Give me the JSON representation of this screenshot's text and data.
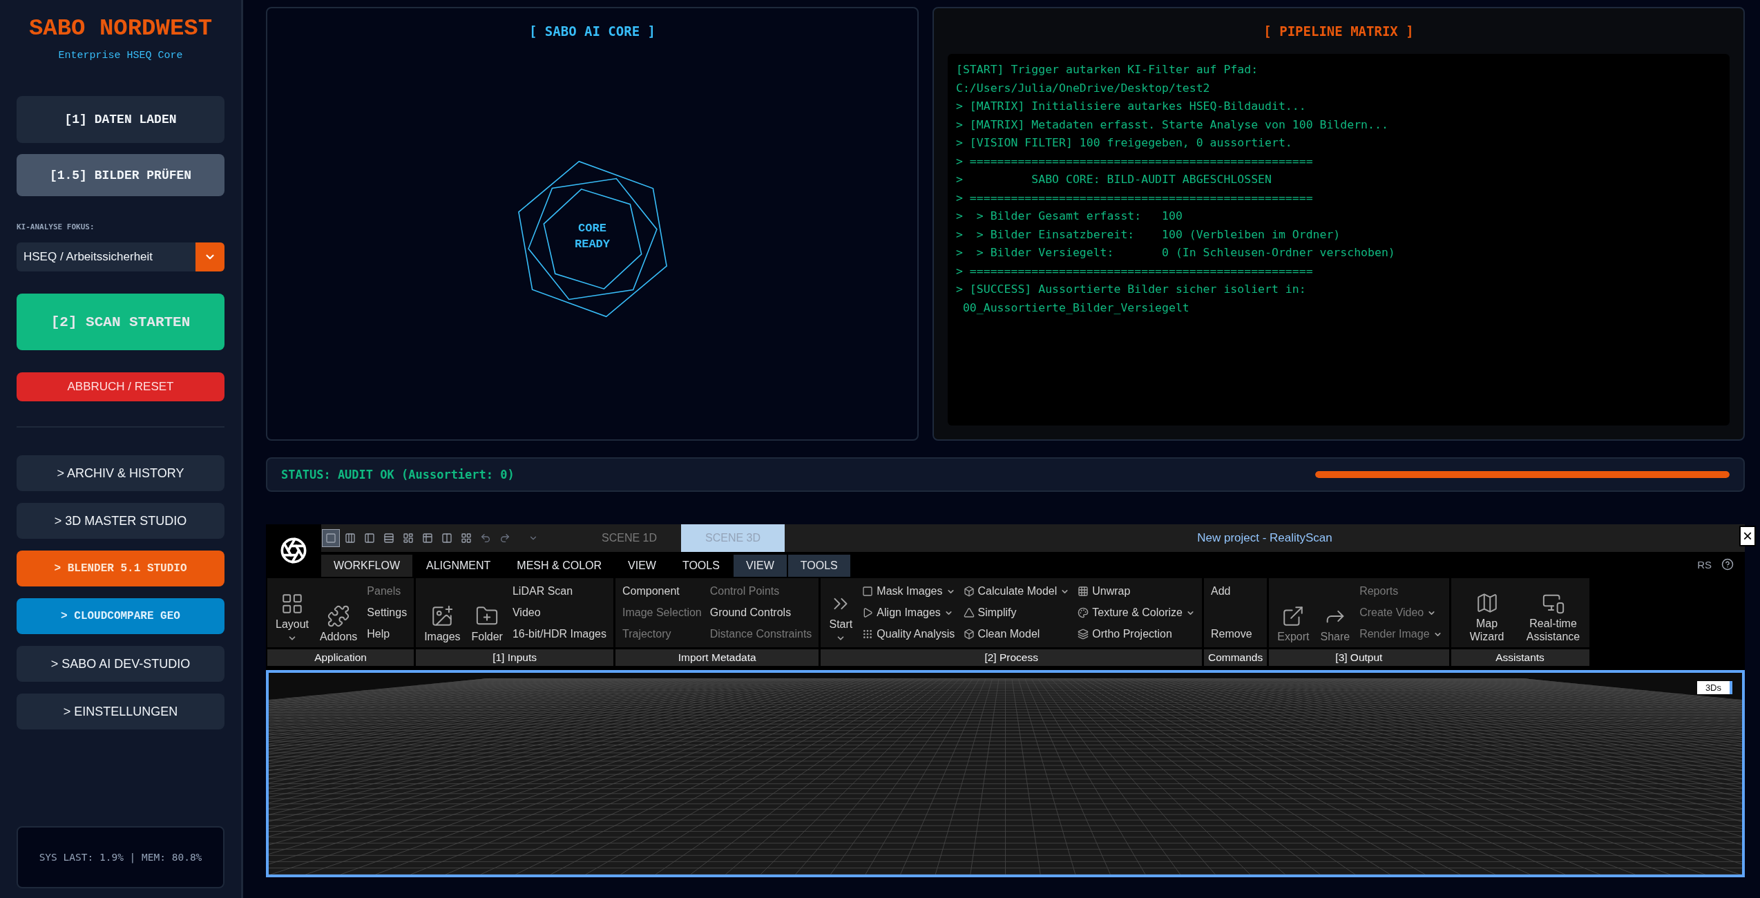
{
  "sidebar": {
    "brand": "SABO NORDWEST",
    "subtitle": "Enterprise HSEQ Core",
    "actions": [
      {
        "label": "[1] DATEN LADEN",
        "kind": "primary"
      },
      {
        "label": "[1.5] BILDER PRÜFEN",
        "kind": "secondary"
      }
    ],
    "focus": {
      "label": "KI-ANALYSE FOKUS:",
      "value": "HSEQ / Arbeitssicherheit"
    },
    "run_actions": [
      {
        "label": "[2] SCAN STARTEN",
        "kind": "scan"
      },
      {
        "label": "ABBRUCH / RESET",
        "kind": "danger"
      }
    ],
    "nav": [
      {
        "label": "> ARCHIV & HISTORY",
        "kind": "plain"
      },
      {
        "label": "> 3D MASTER STUDIO",
        "kind": "plain"
      },
      {
        "label": "> BLENDER 5.1 STUDIO",
        "kind": "orange"
      },
      {
        "label": "> CLOUDCOMPARE GEO",
        "kind": "blue"
      },
      {
        "label": "> SABO AI DEV-STUDIO",
        "kind": "plain"
      },
      {
        "label": "> EINSTELLUNGEN",
        "kind": "plain"
      }
    ],
    "sys": "SYS LAST: 1.9% | MEM: 80.8%"
  },
  "core": {
    "title": "[ SABO AI CORE ]",
    "lines": [
      "CORE",
      "READY"
    ]
  },
  "pipeline": {
    "title": "[ PIPELINE MATRIX ]",
    "log": [
      "[START] Trigger autarken KI-Filter auf Pfad:",
      "C:/Users/Julia/OneDrive/Desktop/test2",
      "> [MATRIX] Initialisiere autarkes HSEQ-Bildaudit...",
      "> [MATRIX] Metadaten erfasst. Starte Analyse von 100 Bildern...",
      "> [VISION FILTER] 100 freigegeben, 0 aussortiert.",
      "> ==================================================",
      ">          SABO CORE: BILD-AUDIT ABGESCHLOSSEN",
      "> ==================================================",
      ">  > Bilder Gesamt erfasst:   100",
      ">  > Bilder Einsatzbereit:    100 (Verbleiben im Ordner)",
      ">  > Bilder Versiegelt:       0 (In Schleusen-Ordner verschoben)",
      "> ==================================================",
      "> [SUCCESS] Aussortierte Bilder sicher isoliert in:",
      " 00_Aussortierte_Bilder_Versiegelt"
    ]
  },
  "status": {
    "text": "STATUS: AUDIT OK (Aussortiert: 0)",
    "level": 1
  },
  "realityscan": {
    "title": "New project - RealityScan",
    "close": "×",
    "layouts": [
      {
        "selected": true
      },
      {
        "selected": false
      },
      {
        "selected": false
      },
      {
        "selected": false
      },
      {
        "selected": false
      },
      {
        "selected": false
      },
      {
        "selected": false
      },
      {
        "selected": false
      }
    ],
    "scenes": [
      {
        "label": "SCENE 1D",
        "selected": false
      },
      {
        "label": "SCENE 3D",
        "selected": true
      }
    ],
    "tabs": [
      {
        "label": "WORKFLOW",
        "selected": true,
        "kind": "main"
      },
      {
        "label": "ALIGNMENT",
        "selected": false,
        "kind": "main"
      },
      {
        "label": "MESH & COLOR",
        "selected": false,
        "kind": "main"
      },
      {
        "label": "VIEW",
        "selected": false,
        "kind": "main"
      },
      {
        "label": "TOOLS",
        "selected": false,
        "kind": "main"
      },
      {
        "label": "VIEW",
        "selected": false,
        "kind": "context"
      },
      {
        "label": "TOOLS",
        "selected": false,
        "kind": "context"
      }
    ],
    "rs": "RS",
    "groups": [
      {
        "label": "Application",
        "columns": [
          [
            {
              "label": "Layout",
              "kind": "big",
              "dropdown": true,
              "disabled": false
            }
          ],
          [
            {
              "label": "Addons",
              "kind": "big",
              "dropdown": false,
              "disabled": false
            }
          ],
          [
            {
              "label": "Panels",
              "kind": "small",
              "dropdown": false,
              "disabled": true
            },
            {
              "label": "Settings",
              "kind": "small",
              "dropdown": false,
              "disabled": false
            },
            {
              "label": "Help",
              "kind": "small",
              "dropdown": false,
              "disabled": false
            }
          ]
        ]
      },
      {
        "label": "[1] Inputs",
        "columns": [
          [
            {
              "label": "Images",
              "kind": "big",
              "dropdown": false,
              "disabled": false
            }
          ],
          [
            {
              "label": "Folder",
              "kind": "big",
              "dropdown": false,
              "disabled": false
            }
          ],
          [
            {
              "label": "LiDAR Scan",
              "kind": "small",
              "dropdown": false,
              "disabled": false
            },
            {
              "label": "Video",
              "kind": "small",
              "dropdown": false,
              "disabled": false
            },
            {
              "label": "16-bit/HDR Images",
              "kind": "small",
              "dropdown": false,
              "disabled": false
            }
          ]
        ]
      },
      {
        "label": "Import Metadata",
        "columns": [
          [
            {
              "label": "Component",
              "kind": "small",
              "dropdown": false,
              "disabled": false
            },
            {
              "label": "Image Selection",
              "kind": "small",
              "dropdown": false,
              "disabled": true
            },
            {
              "label": "Trajectory",
              "kind": "small",
              "dropdown": false,
              "disabled": true
            }
          ],
          [
            {
              "label": "Control Points",
              "kind": "small",
              "dropdown": false,
              "disabled": true
            },
            {
              "label": "Ground Controls",
              "kind": "small",
              "dropdown": false,
              "disabled": false
            },
            {
              "label": "Distance Constraints",
              "kind": "small",
              "dropdown": false,
              "disabled": true
            }
          ]
        ]
      },
      {
        "label": "[2] Process",
        "columns": [
          [
            {
              "label": "Start",
              "kind": "big",
              "dropdown": true,
              "disabled": false
            }
          ],
          [
            {
              "label": "Mask Images",
              "kind": "small",
              "dropdown": true,
              "disabled": false
            },
            {
              "label": "Align Images",
              "kind": "small",
              "dropdown": true,
              "disabled": false
            },
            {
              "label": "Quality Analysis",
              "kind": "small",
              "dropdown": false,
              "disabled": false
            }
          ],
          [
            {
              "label": "Calculate Model",
              "kind": "small",
              "dropdown": true,
              "disabled": false
            },
            {
              "label": "Simplify",
              "kind": "small",
              "dropdown": false,
              "disabled": false
            },
            {
              "label": "Clean Model",
              "kind": "small",
              "dropdown": false,
              "disabled": false
            }
          ],
          [
            {
              "label": "Unwrap",
              "kind": "small",
              "dropdown": false,
              "disabled": false
            },
            {
              "label": "Texture & Colorize",
              "kind": "small",
              "dropdown": true,
              "disabled": false
            },
            {
              "label": "Ortho Projection",
              "kind": "small",
              "dropdown": false,
              "disabled": false
            }
          ]
        ]
      },
      {
        "label": "Commands",
        "columns": [
          [
            {
              "label": "Add",
              "kind": "small",
              "dropdown": false,
              "disabled": false
            },
            {
              "label": "Remove",
              "kind": "small",
              "dropdown": false,
              "disabled": false
            }
          ]
        ]
      },
      {
        "label": "[3] Output",
        "columns": [
          [
            {
              "label": "Export",
              "kind": "big",
              "dropdown": false,
              "disabled": true
            }
          ],
          [
            {
              "label": "Share",
              "kind": "big",
              "dropdown": false,
              "disabled": true
            }
          ],
          [
            {
              "label": "Reports",
              "kind": "small",
              "dropdown": false,
              "disabled": true
            },
            {
              "label": "Create Video",
              "kind": "small",
              "dropdown": true,
              "disabled": true
            },
            {
              "label": "Render Image",
              "kind": "small",
              "dropdown": true,
              "disabled": true
            }
          ]
        ]
      },
      {
        "label": "Assistants",
        "columns": [
          [
            {
              "label": "Map Wizard",
              "kind": "big",
              "dropdown": false,
              "disabled": false
            }
          ],
          [
            {
              "label": "Real-time Assistance",
              "kind": "big",
              "dropdown": false,
              "disabled": false
            }
          ]
        ]
      }
    ],
    "viewport_badge": "3Ds"
  }
}
